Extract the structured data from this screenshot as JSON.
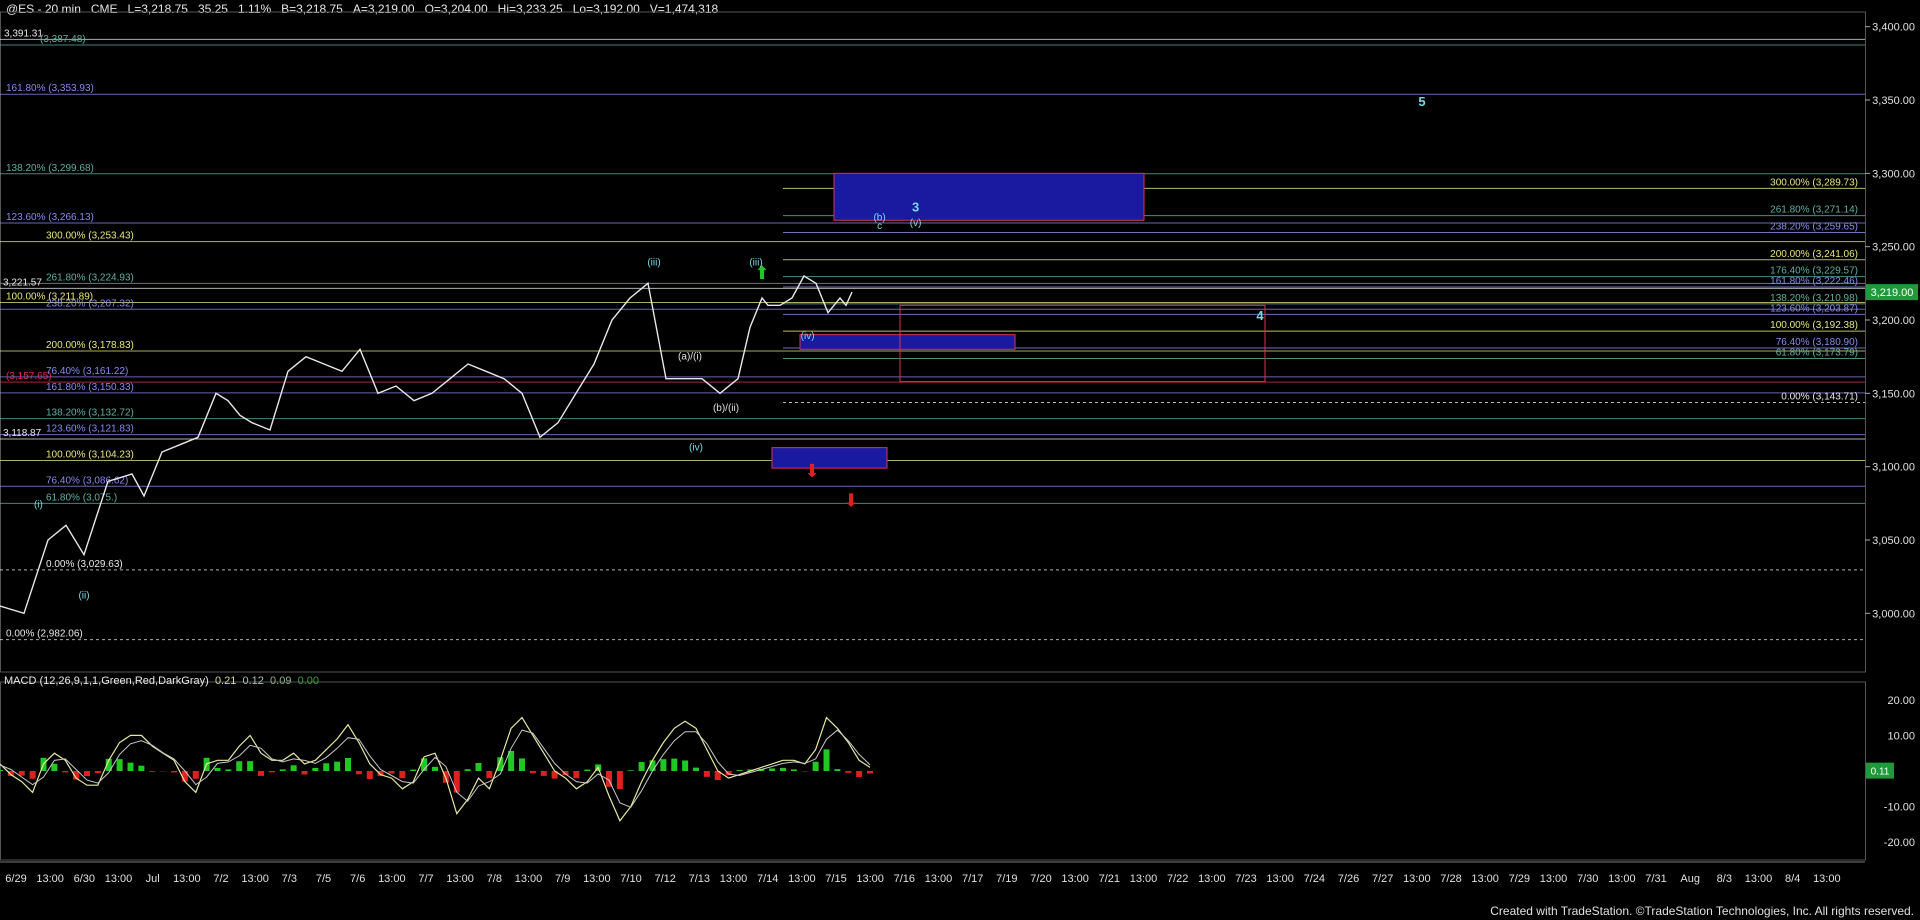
{
  "header": {
    "symbol": "@ES - 20 min",
    "exchange": "CME",
    "last": "L=3,218.75",
    "change": "35.25",
    "change_pct": "1.11%",
    "bid": "B=3,218.75",
    "ask": "A=3,219.00",
    "open": "O=3,204.00",
    "high": "Hi=3,233.25",
    "low": "Lo=3,192.00",
    "volume": "V=1,474,318"
  },
  "macd_header": {
    "label": "MACD (12,26,9,1,1,Green,Red,DarkGray)",
    "v1": "0.21",
    "v2": "0.12",
    "v3": "0.09",
    "v4": "0.00"
  },
  "credit": "Created with TradeStation. ©TradeStation Technologies, Inc. All rights reserved.",
  "colors": {
    "background": "#000000",
    "price": "#e8e8e8",
    "fib_yellow": "#e8e87a",
    "fib_blue": "#8a8af0",
    "fib_teal": "#5fb0a0",
    "wave_label": "#7ad8e8",
    "box_fill": "#1a1aa0",
    "box_border": "#e03050",
    "arrow_up": "#21c821",
    "arrow_down": "#e02020",
    "macd_line": "#e8e8a0",
    "signal_line": "#c8c8c8",
    "hist_pos": "#21c821",
    "hist_neg": "#e02020",
    "price_marker": "#1f9a3a"
  },
  "chart_data": {
    "type": "line",
    "title": "@ES - 20 min",
    "ylim": [
      2960,
      3410
    ],
    "y_ticks": [
      "3,400.00",
      "3,350.00",
      "3,300.00",
      "3,250.00",
      "3,200.00",
      "3,150.00",
      "3,100.00",
      "3,050.00",
      "3,000.00"
    ],
    "y_tick_values": [
      3400,
      3350,
      3300,
      3250,
      3200,
      3150,
      3100,
      3050,
      3000
    ],
    "last_price_label": "3,219.00",
    "last_price": 3219,
    "x_ticks": [
      "6/29",
      "13:00",
      "6/30",
      "13:00",
      "Jul",
      "13:00",
      "7/2",
      "13:00",
      "7/3",
      "7/5",
      "7/6",
      "13:00",
      "7/7",
      "13:00",
      "7/8",
      "13:00",
      "7/9",
      "13:00",
      "7/10",
      "7/12",
      "7/13",
      "13:00",
      "7/14",
      "13:00",
      "7/15",
      "13:00",
      "7/16",
      "13:00",
      "7/17",
      "7/19",
      "7/20",
      "13:00",
      "7/21",
      "13:00",
      "7/22",
      "13:00",
      "7/23",
      "13:00",
      "7/24",
      "7/26",
      "7/27",
      "13:00",
      "7/28",
      "13:00",
      "7/29",
      "13:00",
      "7/30",
      "13:00",
      "7/31",
      "Aug",
      "8/3",
      "13:00",
      "8/4",
      "13:00"
    ],
    "price_series": {
      "name": "@ES 20 min",
      "x": [
        0,
        20,
        40,
        55,
        70,
        90,
        110,
        120,
        135,
        150,
        165,
        180,
        190,
        200,
        210,
        225,
        240,
        255,
        270,
        285,
        300,
        315,
        330,
        345,
        360,
        375,
        390,
        405,
        420,
        435,
        450,
        465,
        480,
        495,
        510,
        525,
        540,
        555,
        570,
        585,
        600,
        615,
        625,
        635,
        640,
        650,
        660,
        670,
        680,
        690,
        700,
        705,
        710
      ],
      "y": [
        3005,
        3000,
        3050,
        3060,
        3040,
        3090,
        3095,
        3080,
        3110,
        3115,
        3120,
        3150,
        3145,
        3135,
        3130,
        3125,
        3165,
        3175,
        3170,
        3165,
        3180,
        3150,
        3155,
        3145,
        3150,
        3160,
        3170,
        3165,
        3160,
        3150,
        3120,
        3130,
        3150,
        3170,
        3200,
        3215,
        3225,
        3160,
        3160,
        3160,
        3150,
        3160,
        3195,
        3215,
        3210,
        3210,
        3215,
        3230,
        3225,
        3205,
        3215,
        3210,
        3219
      ],
      "x_unit": "bar index"
    },
    "fib_levels": [
      {
        "label": "3,391.31",
        "value": 3391.31,
        "color": "#e8e8e8"
      },
      {
        "label": "(3,387.48)",
        "value": 3387.48,
        "color": "#5fb0a0"
      },
      {
        "label": "161.80% (3,353.93)",
        "value": 3353.93,
        "color": "#8a8af0"
      },
      {
        "label": "138.20% (3,299.68)",
        "value": 3299.68,
        "color": "#5fb0a0"
      },
      {
        "label": "123.60% (3,266.13)",
        "value": 3266.13,
        "color": "#8a8af0"
      },
      {
        "label": "300.00% (3,253.43)",
        "value": 3253.43,
        "color": "#e8e87a"
      },
      {
        "label": "261.80% (3,224.93)",
        "value": 3224.93,
        "color": "#5fb0a0"
      },
      {
        "label": "3,221.57",
        "value": 3221.57,
        "color": "#e8e8e8"
      },
      {
        "label": "100.00% (3,211.89)",
        "value": 3211.89,
        "color": "#e8e87a"
      },
      {
        "label": "238.20% (3,207.32)",
        "value": 3207.32,
        "color": "#8a8af0"
      },
      {
        "label": "200.00% (3,178.83)",
        "value": 3178.83,
        "color": "#e8e87a"
      },
      {
        "label": "76.40% (3,161.22)",
        "value": 3161.22,
        "color": "#8a8af0"
      },
      {
        "label": "(3,157.65)",
        "value": 3157.65,
        "color": "#e03050"
      },
      {
        "label": "161.80% (3,150.33)",
        "value": 3150.33,
        "color": "#8a8af0"
      },
      {
        "label": "138.20% (3,132.72)",
        "value": 3132.72,
        "color": "#5fb0a0"
      },
      {
        "label": "123.60% (3,121.83)",
        "value": 3121.83,
        "color": "#8a8af0"
      },
      {
        "label": "3,118.87",
        "value": 3118.87,
        "color": "#e8e8e8"
      },
      {
        "label": "100.00% (3,104.23)",
        "value": 3104.23,
        "color": "#e8e87a"
      },
      {
        "label": "76.40% (3,086.62)",
        "value": 3086.62,
        "color": "#8a8af0"
      },
      {
        "label": "61.80% (3,075.)",
        "value": 3075.0,
        "color": "#5fb0a0"
      },
      {
        "label": "0.00% (3,029.63)",
        "value": 3029.63,
        "color": "#e8e8e8"
      },
      {
        "label": "0.00% (2,982.06)",
        "value": 2982.06,
        "color": "#e8e8e8"
      }
    ],
    "right_fib_levels": [
      {
        "label": "300.00% (3,289.73)",
        "value": 3289.73,
        "color": "#e8e87a"
      },
      {
        "label": "261.80% (3,271.14)",
        "value": 3271.14,
        "color": "#5fb0a0"
      },
      {
        "label": "238.20% (3,259.65)",
        "value": 3259.65,
        "color": "#8a8af0"
      },
      {
        "label": "200.00% (3,241.06)",
        "value": 3241.06,
        "color": "#e8e87a"
      },
      {
        "label": "176.40% (3,229.57)",
        "value": 3229.57,
        "color": "#5fb0a0"
      },
      {
        "label": "161.80% (3,222.46)",
        "value": 3222.46,
        "color": "#8a8af0"
      },
      {
        "label": "138.20% (3,210.98)",
        "value": 3210.98,
        "color": "#5fb0a0"
      },
      {
        "label": "123.60% (3,203.87)",
        "value": 3203.87,
        "color": "#8a8af0"
      },
      {
        "label": "100.00% (3,192.38)",
        "value": 3192.38,
        "color": "#e8e87a"
      },
      {
        "label": "76.40% (3,180.90)",
        "value": 3180.9,
        "color": "#8a8af0"
      },
      {
        "label": "61.80% (3,173.79)",
        "value": 3173.79,
        "color": "#5fb0a0"
      },
      {
        "label": "0.00% (3,143.71)",
        "value": 3143.71,
        "color": "#e8e8e8"
      }
    ],
    "wave_labels": [
      {
        "text": "(i)",
        "bar": 32,
        "price": 3072
      },
      {
        "text": "(ii)",
        "bar": 70,
        "price": 3010
      },
      {
        "text": "(iii)",
        "bar": 545,
        "price": 3237
      },
      {
        "text": "(iii)",
        "bar": 630,
        "price": 3237
      },
      {
        "text": "(a)/(i)",
        "bar": 575,
        "price": 3173
      },
      {
        "text": "(b)/(ii)",
        "bar": 605,
        "price": 3138
      },
      {
        "text": "(iv)",
        "bar": 580,
        "price": 3111
      },
      {
        "text": "(iv)",
        "bar": 673,
        "price": 3187
      },
      {
        "text": "(b)",
        "bar": 733,
        "price": 3268
      },
      {
        "text": "c",
        "bar": 733,
        "price": 3262
      },
      {
        "text": "(v)",
        "bar": 763,
        "price": 3264
      },
      {
        "text": "3",
        "bar": 763,
        "price": 3274
      },
      {
        "text": "4",
        "bar": 1050,
        "price": 3200
      },
      {
        "text": "5",
        "bar": 1185,
        "price": 3346
      }
    ],
    "macd_series": {
      "name": "MACD (12,26,9,1,1,Green,Red,DarkGray)",
      "values": [
        2,
        -1,
        -3,
        -6,
        2,
        5,
        3,
        -2,
        -4,
        -4,
        3,
        8,
        10,
        10,
        7,
        5,
        3,
        -3,
        -6,
        2,
        3,
        3,
        7,
        10,
        5,
        3,
        3,
        5,
        2,
        3,
        6,
        9,
        13,
        8,
        2,
        -1,
        -2,
        -5,
        -3,
        4,
        5,
        -2,
        -12,
        -8,
        -2,
        -5,
        3,
        12,
        15,
        10,
        5,
        0,
        -2,
        -5,
        -3,
        1,
        -7,
        -14,
        -10,
        -3,
        3,
        8,
        12,
        14,
        12,
        6,
        0,
        -2,
        -1,
        0,
        1,
        2,
        3,
        3,
        2,
        6,
        15,
        12,
        8,
        3,
        1
      ],
      "ylim": [
        -25,
        25
      ]
    },
    "macd_y_ticks": [
      "20.00",
      "10.00",
      "-10.00",
      "-20.00"
    ],
    "macd_y_tick_values": [
      20,
      10,
      -10,
      -20
    ],
    "macd_last_label": "0.11",
    "macd_last": 0.11
  }
}
